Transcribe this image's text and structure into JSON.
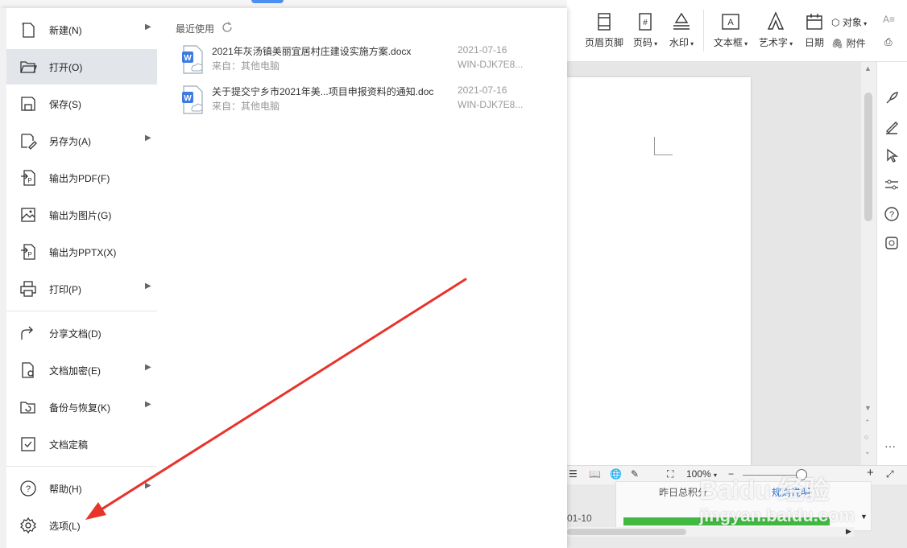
{
  "ribbon": {
    "header_footer": "页眉页脚",
    "page_number": "页码",
    "watermark": "水印",
    "text_box": "文本框",
    "word_art": "艺术字",
    "date": "日期",
    "object": "对象",
    "attachment": "附件"
  },
  "file_menu": {
    "items": [
      {
        "label": "新建(N)",
        "icon": "new-doc-icon",
        "submenu": true
      },
      {
        "label": "打开(O)",
        "icon": "folder-open-icon",
        "submenu": false,
        "active": true
      },
      {
        "label": "保存(S)",
        "icon": "save-icon",
        "submenu": false
      },
      {
        "label": "另存为(A)",
        "icon": "save-as-icon",
        "submenu": true
      },
      {
        "label": "输出为PDF(F)",
        "icon": "pdf-export-icon",
        "submenu": false
      },
      {
        "label": "输出为图片(G)",
        "icon": "image-export-icon",
        "submenu": false
      },
      {
        "label": "输出为PPTX(X)",
        "icon": "pptx-export-icon",
        "submenu": false
      },
      {
        "label": "打印(P)",
        "icon": "print-icon",
        "submenu": true
      },
      {
        "label": "分享文档(D)",
        "icon": "share-icon",
        "submenu": false
      },
      {
        "label": "文档加密(E)",
        "icon": "encrypt-icon",
        "submenu": true
      },
      {
        "label": "备份与恢复(K)",
        "icon": "backup-icon",
        "submenu": true
      },
      {
        "label": "文档定稿",
        "icon": "finalize-icon",
        "submenu": false
      },
      {
        "label": "帮助(H)",
        "icon": "help-icon",
        "submenu": true
      },
      {
        "label": "选项(L)",
        "icon": "gear-icon",
        "submenu": false
      }
    ],
    "submenu_arrow": "▶"
  },
  "recent": {
    "title": "最近使用",
    "files": [
      {
        "name": "2021年灰汤镇美丽宜居村庄建设实施方案.docx",
        "source": "来自：其他电脑",
        "date": "2021-07-16",
        "host": "WIN-DJK7E8..."
      },
      {
        "name": "关于提交宁乡市2021年美...项目申报资料的通知.doc",
        "source": "来自：其他电脑",
        "date": "2021-07-16",
        "host": "WIN-DJK7E8..."
      }
    ]
  },
  "status": {
    "zoom": "100%",
    "minus": "−",
    "plus": "+",
    "zoom_dropdown": "▾"
  },
  "task_panel": {
    "yesterday_label": "昨日总积分",
    "explain_label": "规则说明",
    "date_fragment": "01-10"
  },
  "watermark": {
    "logo": "Baidu 经验",
    "url": "jingyan.baidu.com"
  },
  "colors": {
    "accent": "#4d8ff0",
    "arrow": "#e8332a",
    "active_item_bg": "#e2e5ea",
    "progress_green": "#3fb93f"
  }
}
